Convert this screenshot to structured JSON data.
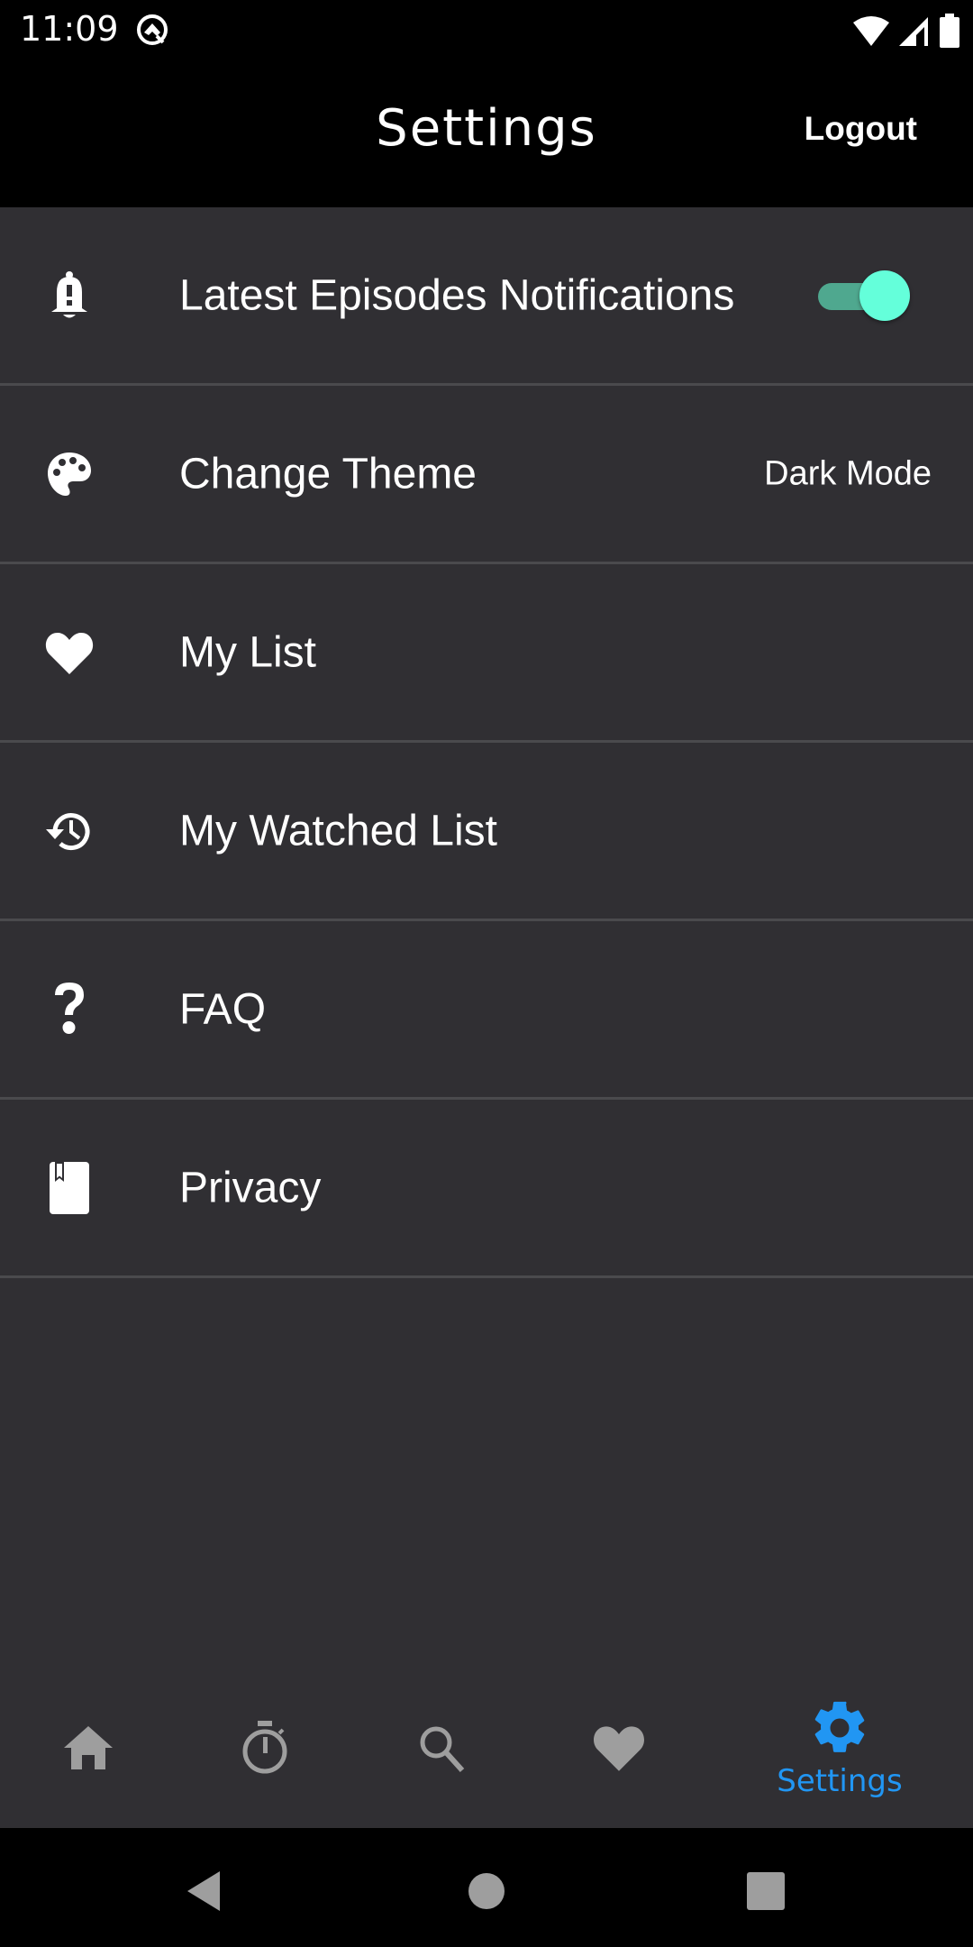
{
  "status_bar": {
    "time": "11:09",
    "icons": [
      "q-logo-icon",
      "wifi-icon",
      "signal-icon",
      "battery-icon"
    ]
  },
  "app_bar": {
    "title": "Settings",
    "logout_label": "Logout"
  },
  "settings": {
    "items": [
      {
        "icon": "bell-alert-icon",
        "label": "Latest Episodes Notifications",
        "control": "toggle",
        "enabled": true
      },
      {
        "icon": "palette-icon",
        "label": "Change Theme",
        "value": "Dark Mode"
      },
      {
        "icon": "heart-icon",
        "label": "My List"
      },
      {
        "icon": "history-icon",
        "label": "My Watched List"
      },
      {
        "icon": "question-icon",
        "label": "FAQ"
      },
      {
        "icon": "book-icon",
        "label": "Privacy"
      }
    ]
  },
  "bottom_nav": {
    "items": [
      {
        "icon": "home-icon",
        "label": "",
        "active": false
      },
      {
        "icon": "timer-icon",
        "label": "",
        "active": false
      },
      {
        "icon": "search-icon",
        "label": "",
        "active": false
      },
      {
        "icon": "heart-icon",
        "label": "",
        "active": false
      },
      {
        "icon": "gear-icon",
        "label": "Settings",
        "active": true
      }
    ]
  },
  "colors": {
    "background": "#302f33",
    "bar_background": "#000000",
    "divider": "#4a4a4d",
    "accent": "#2196f3",
    "toggle_thumb": "#64ffda",
    "toggle_track": "#4fa88f",
    "inactive_icon": "#9e9e9e"
  }
}
